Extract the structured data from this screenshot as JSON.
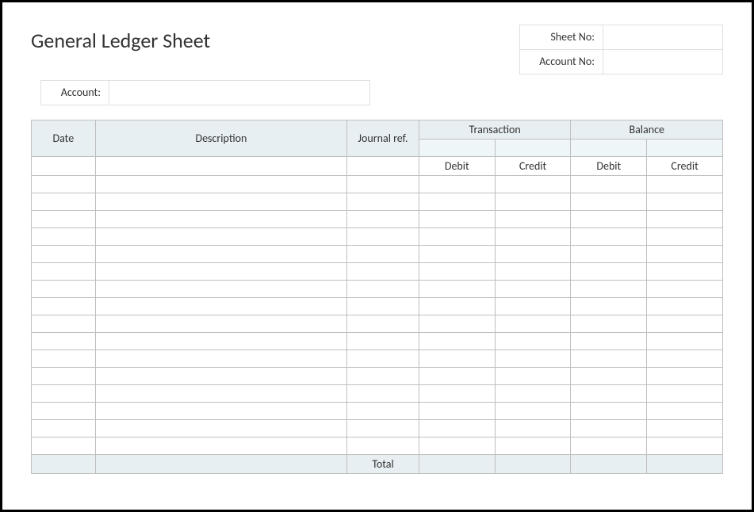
{
  "title": "General Ledger Sheet",
  "fields": {
    "sheet_no_label": "Sheet No:",
    "sheet_no_value": "",
    "account_no_label": "Account No:",
    "account_no_value": "",
    "account_label": "Account:",
    "account_value": ""
  },
  "headers": {
    "date": "Date",
    "description": "Description",
    "journal_ref": "Journal ref.",
    "transaction": "Transaction",
    "balance": "Balance",
    "debit": "Debit",
    "credit": "Credit"
  },
  "rows": [
    {
      "date": "",
      "description": "",
      "journal_ref": "",
      "t_debit": "",
      "t_credit": "",
      "b_debit": "",
      "b_credit": ""
    },
    {
      "date": "",
      "description": "",
      "journal_ref": "",
      "t_debit": "",
      "t_credit": "",
      "b_debit": "",
      "b_credit": ""
    },
    {
      "date": "",
      "description": "",
      "journal_ref": "",
      "t_debit": "",
      "t_credit": "",
      "b_debit": "",
      "b_credit": ""
    },
    {
      "date": "",
      "description": "",
      "journal_ref": "",
      "t_debit": "",
      "t_credit": "",
      "b_debit": "",
      "b_credit": ""
    },
    {
      "date": "",
      "description": "",
      "journal_ref": "",
      "t_debit": "",
      "t_credit": "",
      "b_debit": "",
      "b_credit": ""
    },
    {
      "date": "",
      "description": "",
      "journal_ref": "",
      "t_debit": "",
      "t_credit": "",
      "b_debit": "",
      "b_credit": ""
    },
    {
      "date": "",
      "description": "",
      "journal_ref": "",
      "t_debit": "",
      "t_credit": "",
      "b_debit": "",
      "b_credit": ""
    },
    {
      "date": "",
      "description": "",
      "journal_ref": "",
      "t_debit": "",
      "t_credit": "",
      "b_debit": "",
      "b_credit": ""
    },
    {
      "date": "",
      "description": "",
      "journal_ref": "",
      "t_debit": "",
      "t_credit": "",
      "b_debit": "",
      "b_credit": ""
    },
    {
      "date": "",
      "description": "",
      "journal_ref": "",
      "t_debit": "",
      "t_credit": "",
      "b_debit": "",
      "b_credit": ""
    },
    {
      "date": "",
      "description": "",
      "journal_ref": "",
      "t_debit": "",
      "t_credit": "",
      "b_debit": "",
      "b_credit": ""
    },
    {
      "date": "",
      "description": "",
      "journal_ref": "",
      "t_debit": "",
      "t_credit": "",
      "b_debit": "",
      "b_credit": ""
    },
    {
      "date": "",
      "description": "",
      "journal_ref": "",
      "t_debit": "",
      "t_credit": "",
      "b_debit": "",
      "b_credit": ""
    },
    {
      "date": "",
      "description": "",
      "journal_ref": "",
      "t_debit": "",
      "t_credit": "",
      "b_debit": "",
      "b_credit": ""
    },
    {
      "date": "",
      "description": "",
      "journal_ref": "",
      "t_debit": "",
      "t_credit": "",
      "b_debit": "",
      "b_credit": ""
    },
    {
      "date": "",
      "description": "",
      "journal_ref": "",
      "t_debit": "",
      "t_credit": "",
      "b_debit": "",
      "b_credit": ""
    }
  ],
  "total_label": "Total",
  "totals": {
    "t_debit": "",
    "t_credit": "",
    "b_debit": "",
    "b_credit": ""
  }
}
